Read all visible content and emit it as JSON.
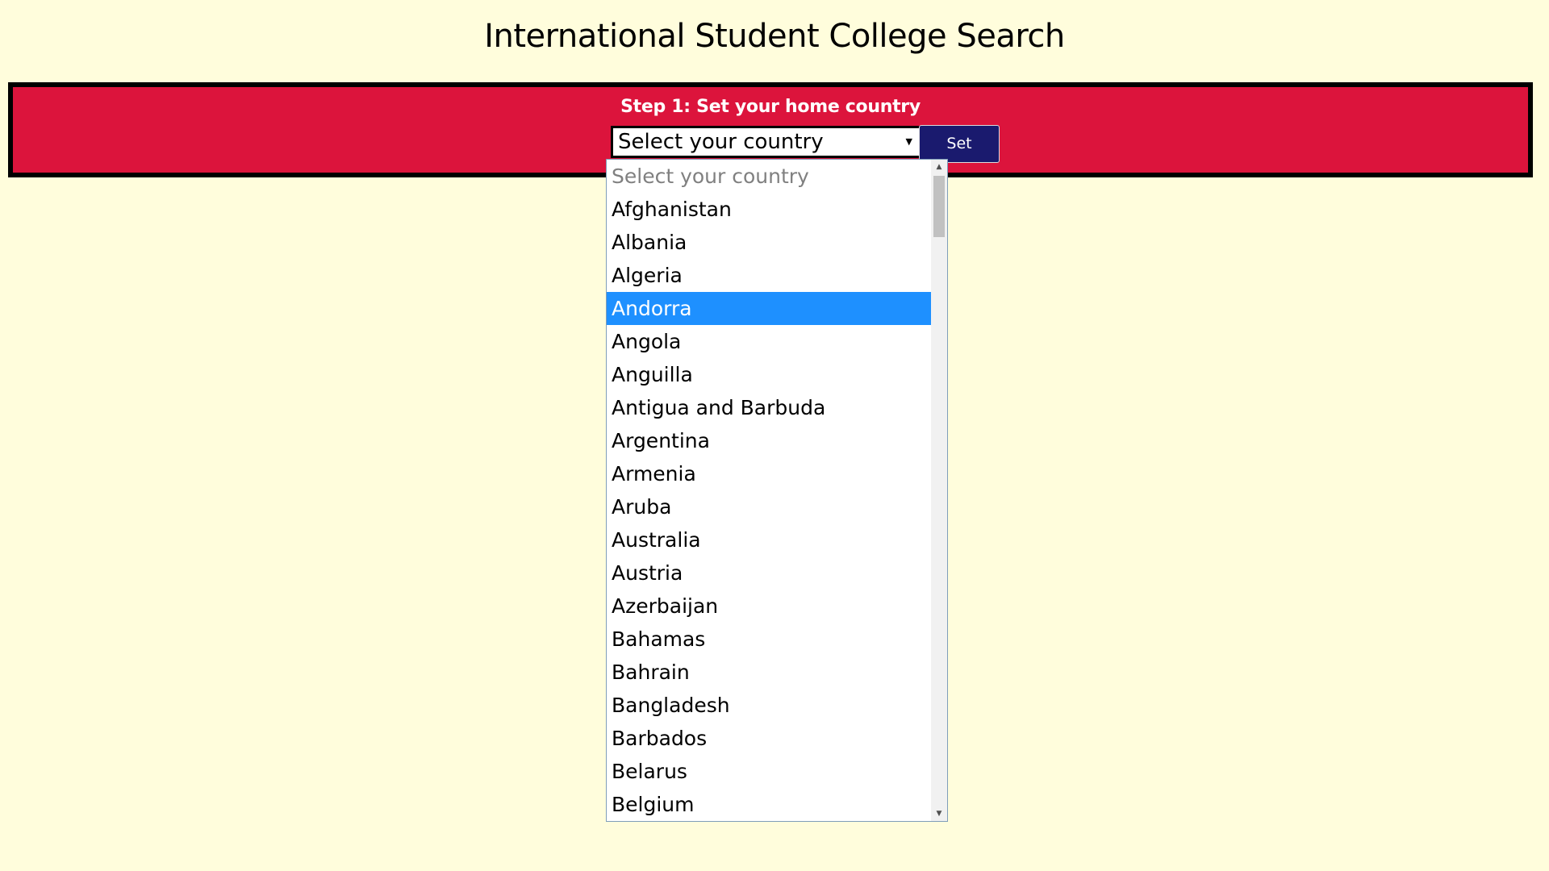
{
  "page": {
    "title": "International Student College Search"
  },
  "step1": {
    "heading": "Step 1: Set your home country",
    "select_value": "Select your country",
    "set_button_label": "Set"
  },
  "dropdown": {
    "options": [
      "Select your country",
      "Afghanistan",
      "Albania",
      "Algeria",
      "Andorra",
      "Angola",
      "Anguilla",
      "Antigua and Barbuda",
      "Argentina",
      "Armenia",
      "Aruba",
      "Australia",
      "Austria",
      "Azerbaijan",
      "Bahamas",
      "Bahrain",
      "Bangladesh",
      "Barbados",
      "Belarus",
      "Belgium"
    ],
    "highlighted_option": "Andorra"
  },
  "colors": {
    "background": "#FFFDDC",
    "panel": "#DC143C",
    "button": "#1A1A6E",
    "highlight": "#1E90FF"
  },
  "icons": {
    "select_chevron": "chevron-down-icon",
    "scroll_up": "scroll-up-arrow-icon",
    "scroll_down": "scroll-down-arrow-icon"
  }
}
